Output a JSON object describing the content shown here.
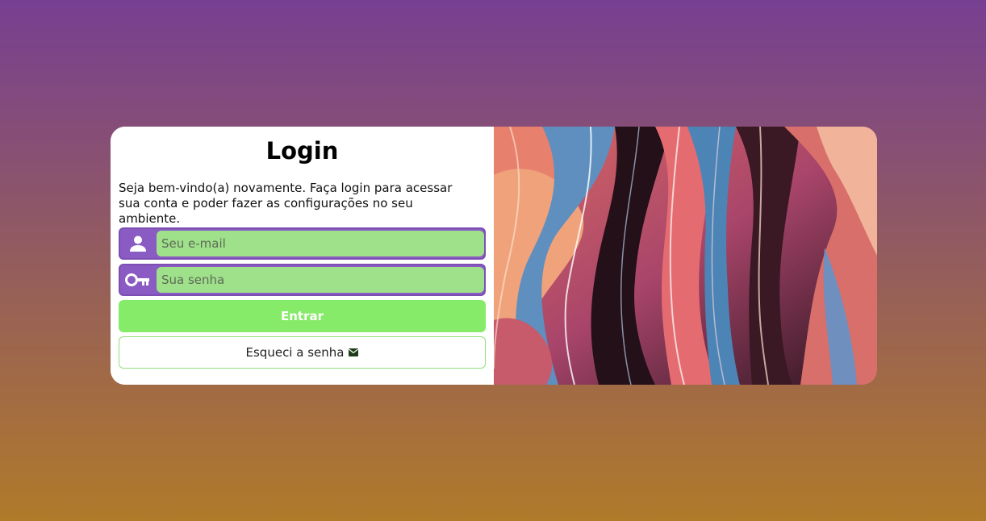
{
  "login": {
    "title": "Login",
    "intro": "Seja bem-vindo(a) novamente. Faça login para acessar sua conta e poder fazer as configurações no seu ambiente.",
    "email": {
      "placeholder": "Seu e-mail",
      "icon": "user-icon"
    },
    "password": {
      "placeholder": "Sua senha",
      "icon": "key-icon"
    },
    "submit_label": "Entrar",
    "forgot_label": "Esqueci a senha",
    "forgot_icon": "envelope-icon"
  },
  "colors": {
    "background_top": "#773f91",
    "background_bottom": "#b07a2a",
    "field_accent": "#8a5bc2",
    "field_fill": "#9fe08b",
    "button_green": "#86eb68"
  }
}
